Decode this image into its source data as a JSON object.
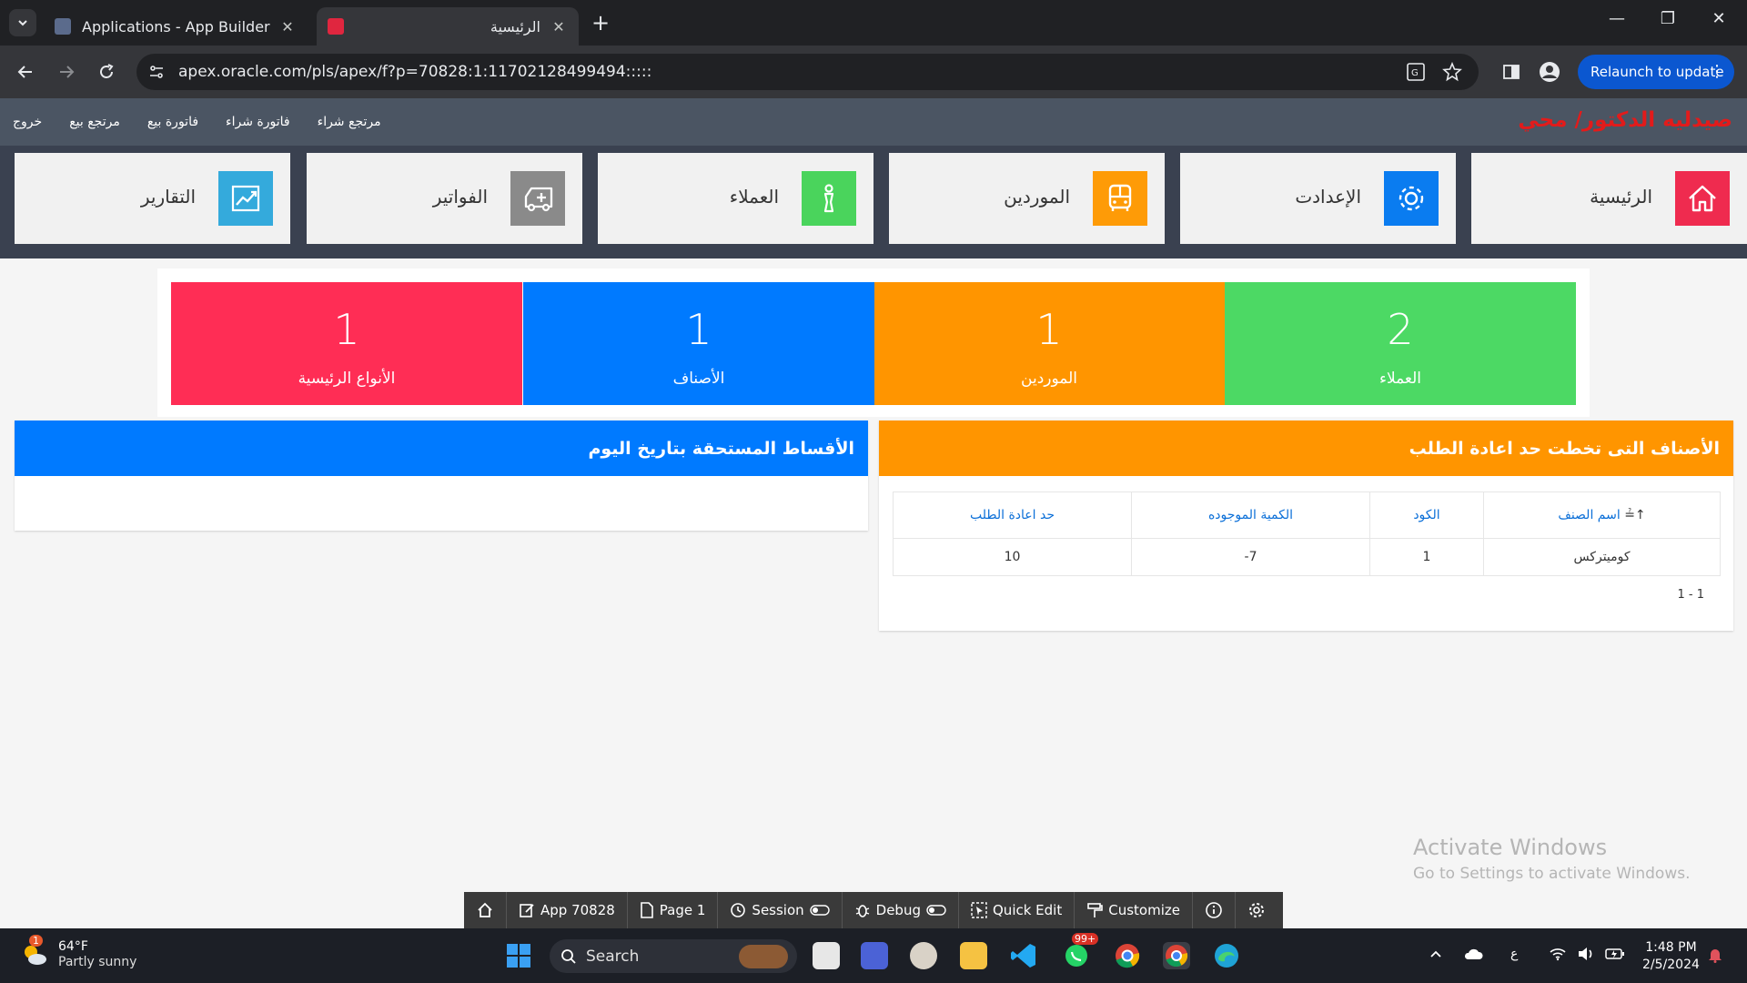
{
  "browser": {
    "tabs": [
      {
        "label": "Applications - App Builder",
        "active": false
      },
      {
        "label": "الرئيسية",
        "active": true
      }
    ],
    "url": "apex.oracle.com/pls/apex/f?p=70828:1:11702128499494:::::",
    "relaunch_label": "Relaunch to update"
  },
  "app": {
    "brand": "صيدليه الدكتور/ محي",
    "nav_links": [
      "خروج",
      "مرتجع بيع",
      "فاتورة بيع",
      "فاتورة شراء",
      "مرتجع شراء"
    ],
    "cards": [
      {
        "label": "الرئيسية",
        "icon": "home-icon",
        "color": "#ef2b4f"
      },
      {
        "label": "الإعدادت",
        "icon": "gear-icon",
        "color": "#0a7cf0"
      },
      {
        "label": "الموردين",
        "icon": "bus-icon",
        "color": "#fe9b07"
      },
      {
        "label": "العملاء",
        "icon": "person-icon",
        "color": "#4ad45c"
      },
      {
        "label": "الفواتير",
        "icon": "ambulance-icon",
        "color": "#8a8a8a"
      },
      {
        "label": "التقارير",
        "icon": "chart-line-icon",
        "color": "#34aadc"
      }
    ],
    "stats": [
      {
        "value": "2",
        "label": "العملاء",
        "color": "#4cd964"
      },
      {
        "value": "1",
        "label": "الموردين",
        "color": "#ff9500"
      },
      {
        "value": "1",
        "label": "الأصناف",
        "color": "#007aff"
      },
      {
        "value": "1",
        "label": "الأنواع الرئيسية",
        "color": "#ff2d55"
      }
    ]
  },
  "reorder_panel": {
    "title": "الأصناف التى تخطت حد اعادة الطلب",
    "color": "#ff9500",
    "columns": [
      "اسم الصنف",
      "الكود",
      "الكمية الموجوده",
      "حد اعادة الطلب"
    ],
    "rows": [
      [
        "كوميتركس",
        "1",
        "7-",
        "10"
      ]
    ],
    "pagination": "1 - 1"
  },
  "installments_panel": {
    "title": "الأقساط المستحقة بتاريخ اليوم",
    "color": "#007aff"
  },
  "watermark": {
    "line1": "Activate Windows",
    "line2": "Go to Settings to activate Windows."
  },
  "dev_toolbar": {
    "items": [
      "App 70828",
      "Page 1",
      "Session",
      "Debug",
      "Quick Edit",
      "Customize"
    ]
  },
  "taskbar": {
    "weather_temp": "64°F",
    "weather_desc": "Partly sunny",
    "weather_badge": "1",
    "search_label": "Search",
    "whatsapp_badge": "99+",
    "lang": "ع",
    "time": "1:48 PM",
    "date": "2/5/2024"
  }
}
